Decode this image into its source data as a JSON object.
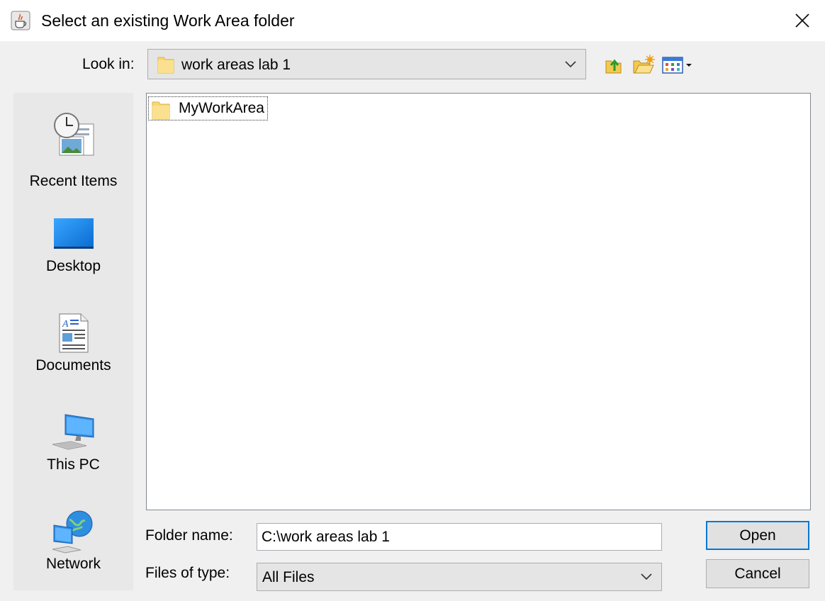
{
  "window": {
    "title": "Select an existing Work Area folder",
    "icon": "java-cup-icon"
  },
  "lookin": {
    "label": "Look in:",
    "value": "work areas lab 1"
  },
  "toolbar": {
    "icons": [
      "up-one-level-icon",
      "create-new-folder-icon",
      "view-menu-icon"
    ]
  },
  "places": [
    {
      "label": "Recent Items",
      "icon": "recent-items-icon"
    },
    {
      "label": "Desktop",
      "icon": "desktop-icon"
    },
    {
      "label": "Documents",
      "icon": "documents-icon"
    },
    {
      "label": "This PC",
      "icon": "this-pc-icon"
    },
    {
      "label": "Network",
      "icon": "network-icon"
    }
  ],
  "files": [
    {
      "name": "MyWorkArea",
      "icon": "folder-icon"
    }
  ],
  "folder_name": {
    "label": "Folder name:",
    "value": "C:\\work areas lab 1"
  },
  "file_type": {
    "label": "Files of type:",
    "value": "All Files"
  },
  "buttons": {
    "open": "Open",
    "cancel": "Cancel"
  },
  "colors": {
    "folder": "#f8d775",
    "accent": "#0078d7"
  }
}
